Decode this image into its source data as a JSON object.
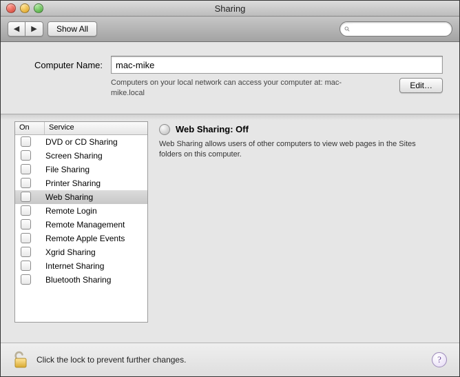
{
  "window": {
    "title": "Sharing"
  },
  "toolbar": {
    "show_all": "Show All",
    "search_placeholder": ""
  },
  "computer_name": {
    "label": "Computer Name:",
    "value": "mac-mike",
    "subtext": "Computers on your local network can access your computer at: mac-mike.local",
    "edit_label": "Edit…"
  },
  "services": {
    "columns": {
      "on": "On",
      "service": "Service"
    },
    "rows": [
      {
        "label": "DVD or CD Sharing",
        "on": false,
        "selected": false
      },
      {
        "label": "Screen Sharing",
        "on": false,
        "selected": false
      },
      {
        "label": "File Sharing",
        "on": false,
        "selected": false
      },
      {
        "label": "Printer Sharing",
        "on": false,
        "selected": false
      },
      {
        "label": "Web Sharing",
        "on": false,
        "selected": true
      },
      {
        "label": "Remote Login",
        "on": false,
        "selected": false
      },
      {
        "label": "Remote Management",
        "on": false,
        "selected": false
      },
      {
        "label": "Remote Apple Events",
        "on": false,
        "selected": false
      },
      {
        "label": "Xgrid Sharing",
        "on": false,
        "selected": false
      },
      {
        "label": "Internet Sharing",
        "on": false,
        "selected": false
      },
      {
        "label": "Bluetooth Sharing",
        "on": false,
        "selected": false
      }
    ]
  },
  "detail": {
    "title": "Web Sharing: Off",
    "description": "Web Sharing allows users of other computers to view web pages in the Sites folders on this computer."
  },
  "footer": {
    "lock_text": "Click the lock to prevent further changes."
  }
}
